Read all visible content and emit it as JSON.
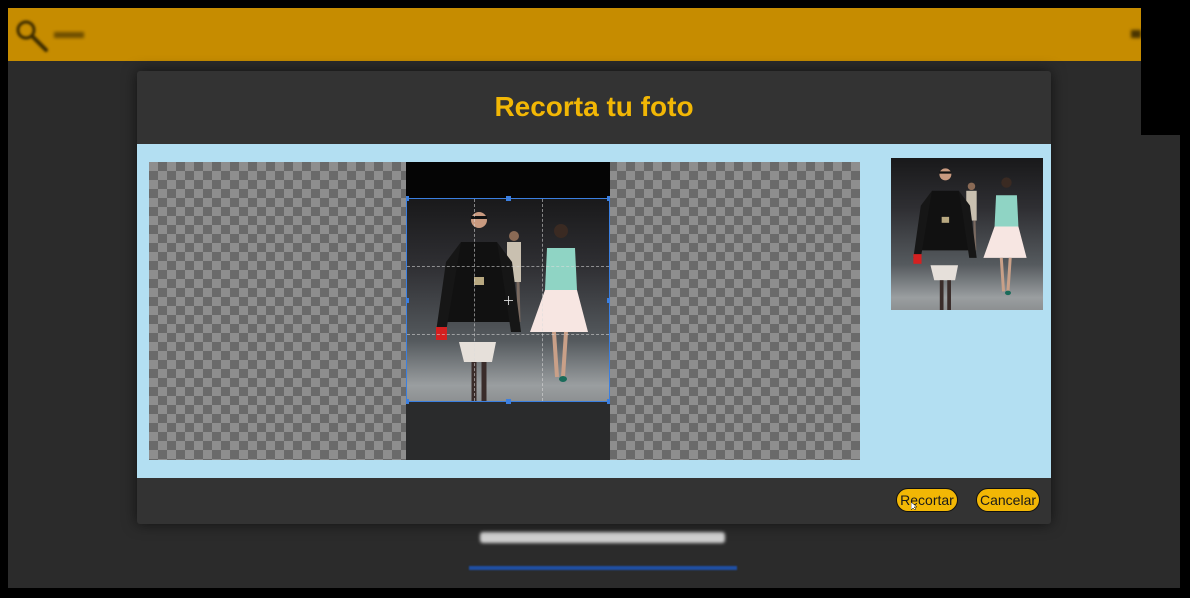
{
  "app": {
    "header_color": "#c68c00",
    "logo_icon": "magnifier-icon"
  },
  "dialog": {
    "title": "Recorta tu foto",
    "title_color": "#f2b705",
    "body_color": "#b3dff2",
    "crop_label": "Recortar",
    "cancel_label": "Cancelar",
    "accent": "#3b7fe0"
  }
}
